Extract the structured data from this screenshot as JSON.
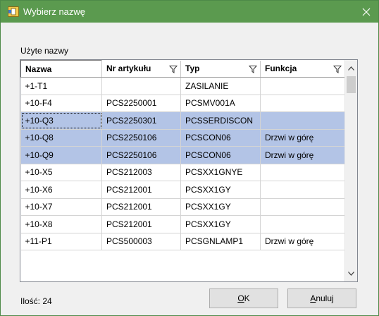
{
  "window": {
    "title": "Wybierz nazwę",
    "close_glyph": "✕"
  },
  "group_label": "Użyte nazwy",
  "columns": [
    "Nazwa",
    "Nr artykułu",
    "Typ",
    "Funkcja"
  ],
  "rows": [
    {
      "nazwa": "+1-T1",
      "nr": "",
      "typ": "ZASILANIE",
      "funkcja": "",
      "selected": false
    },
    {
      "nazwa": "+10-F4",
      "nr": "PCS2250001",
      "typ": "PCSMV001A",
      "funkcja": "",
      "selected": false
    },
    {
      "nazwa": "+10-Q3",
      "nr": "PCS2250301",
      "typ": "PCSSERDISCON",
      "funkcja": "",
      "selected": true,
      "focused": true
    },
    {
      "nazwa": "+10-Q8",
      "nr": "PCS2250106",
      "typ": "PCSCON06",
      "funkcja": "Drzwi w górę",
      "selected": true
    },
    {
      "nazwa": "+10-Q9",
      "nr": "PCS2250106",
      "typ": "PCSCON06",
      "funkcja": "Drzwi w górę",
      "selected": true
    },
    {
      "nazwa": "+10-X5",
      "nr": "PCS212003",
      "typ": "PCSXX1GNYE",
      "funkcja": "",
      "selected": false
    },
    {
      "nazwa": "+10-X6",
      "nr": "PCS212001",
      "typ": "PCSXX1GY",
      "funkcja": "",
      "selected": false
    },
    {
      "nazwa": "+10-X7",
      "nr": "PCS212001",
      "typ": "PCSXX1GY",
      "funkcja": "",
      "selected": false
    },
    {
      "nazwa": "+10-X8",
      "nr": "PCS212001",
      "typ": "PCSXX1GY",
      "funkcja": "",
      "selected": false
    },
    {
      "nazwa": "+11-P1",
      "nr": "PCS500003",
      "typ": "PCSGNLAMP1",
      "funkcja": "Drzwi w górę",
      "selected": false
    }
  ],
  "count_label": "Ilość: 24",
  "buttons": {
    "ok": {
      "mnemonic": "O",
      "rest": "K"
    },
    "cancel": {
      "mnemonic": "A",
      "rest": "nuluj"
    }
  },
  "colors": {
    "titlebar": "#5b9a4f",
    "selection": "#b3c4e6"
  },
  "icons": [
    "app-icon",
    "close-icon",
    "filter-icon",
    "scroll-up-icon",
    "scroll-down-icon"
  ]
}
